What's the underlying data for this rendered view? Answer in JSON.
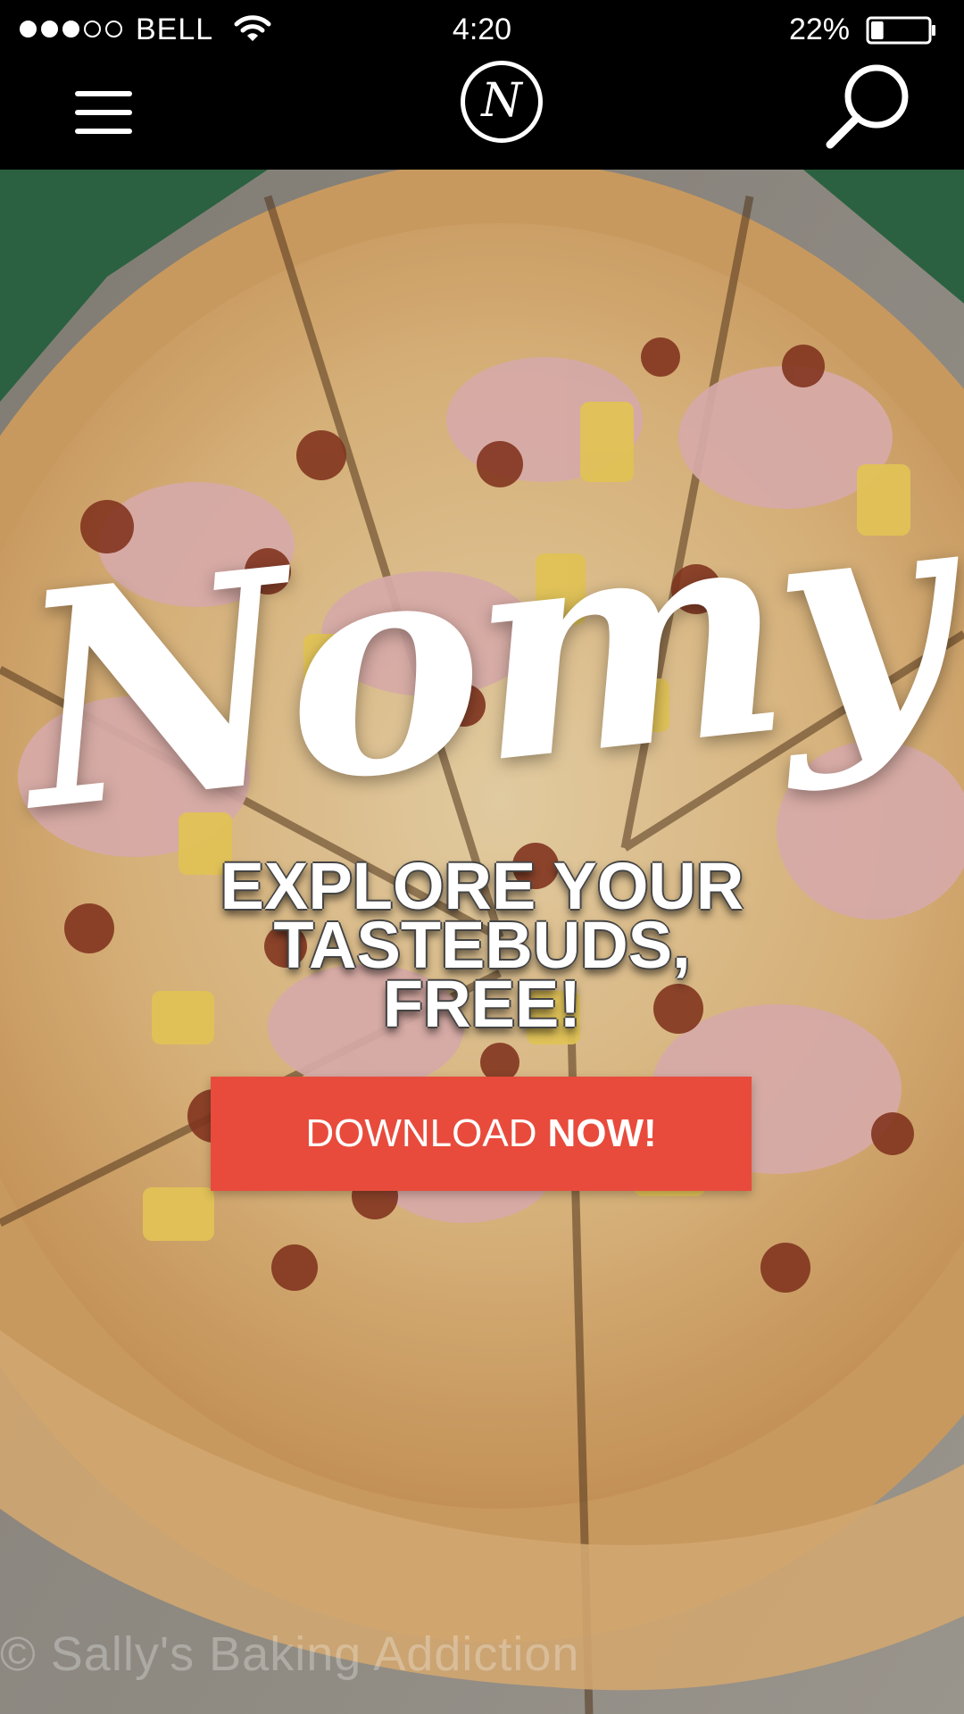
{
  "status_bar": {
    "carrier": "BELL",
    "time": "4:20",
    "battery_percent": "22%",
    "signal_bars_filled": 3,
    "signal_bars_total": 5,
    "battery_level": 0.22,
    "icons": [
      "signal-dots-icon",
      "wifi-icon",
      "battery-icon"
    ]
  },
  "nav_bar": {
    "menu_icon": "hamburger-menu-icon",
    "logo_letter": "N",
    "search_icon": "search-icon"
  },
  "hero": {
    "brand_script": "Nomy",
    "tagline_lines": [
      "EXPLORE YOUR",
      "TASTEBUDS,",
      "FREE!"
    ],
    "cta": {
      "label_regular": "DOWNLOAD",
      "label_bold": "NOW!"
    },
    "watermark": "© Sally's Baking Addiction"
  },
  "colors": {
    "bar_background": "#000000",
    "cta_background": "#e84b3c",
    "text": "#ffffff"
  }
}
